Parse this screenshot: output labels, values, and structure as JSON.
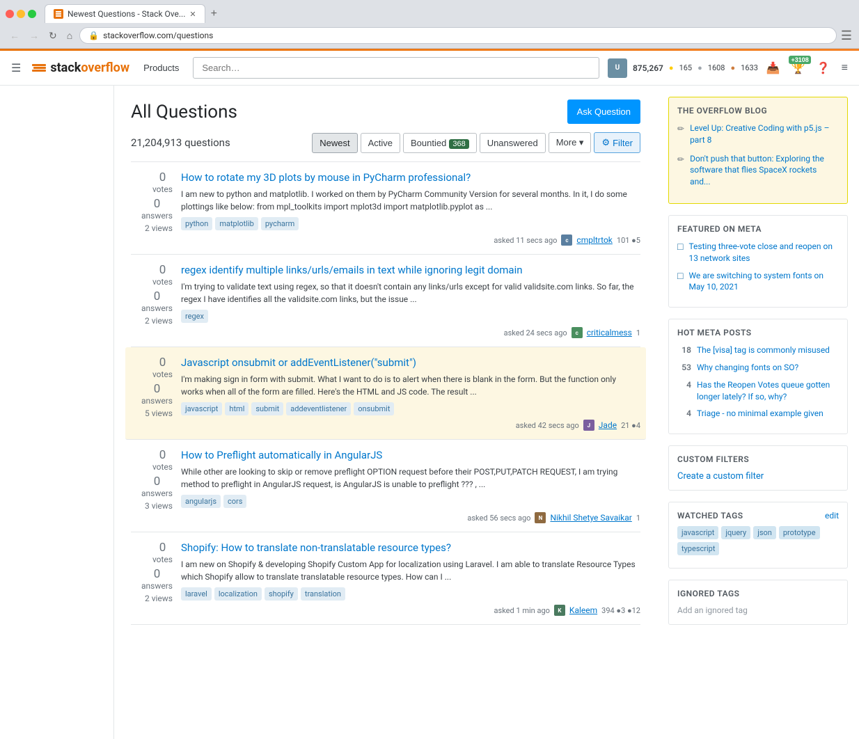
{
  "browser": {
    "tab_title": "Newest Questions - Stack Ove...",
    "url": "stackoverflow.com/questions",
    "nav_back_disabled": true,
    "nav_forward_disabled": true
  },
  "header": {
    "logo_text_main": "stack",
    "logo_text_accent": "overflow",
    "products_label": "Products",
    "search_placeholder": "Search…",
    "user_rep": "875,267",
    "gold_count": "165",
    "silver_count": "1608",
    "bronze_count": "1633",
    "notif_badge": "+3108",
    "hamburger_label": "≡"
  },
  "page": {
    "title": "All Questions",
    "ask_button": "Ask Question",
    "questions_count": "21,204,913 questions",
    "filters": {
      "newest": "Newest",
      "active": "Active",
      "bountied": "Bountied",
      "bountied_count": "368",
      "unanswered": "Unanswered",
      "more": "More",
      "filter": "Filter"
    }
  },
  "questions": [
    {
      "id": 1,
      "votes": 0,
      "answers": 0,
      "views": 2,
      "title": "How to rotate my 3D plots by mouse in PyCharm professional?",
      "excerpt": "I am new to python and matplotlib. I worked on them by PyCharm Community Version for several months. In it, I do some plottings like below: from mpl_toolkits import mplot3d import matplotlib.pyplot as ...",
      "tags": [
        "python",
        "matplotlib",
        "pycharm"
      ],
      "asked_ago": "asked 11 secs ago",
      "user_name": "cmpltrtok",
      "user_rep": "101",
      "user_bronze": "5",
      "avatar_color": "#5a7fa0",
      "highlighted": false
    },
    {
      "id": 2,
      "votes": 0,
      "answers": 0,
      "views": 2,
      "title": "regex identify multiple links/urls/emails in text while ignoring legit domain",
      "excerpt": "I'm trying to validate text using regex, so that it doesn't contain any links/urls except for valid validsite.com links. So far, the regex I have identifies all the validsite.com links, but the issue ...",
      "tags": [
        "regex"
      ],
      "asked_ago": "asked 24 secs ago",
      "user_name": "criticalmess",
      "user_rep": "1",
      "user_bronze": "",
      "avatar_color": "#4a8f5f",
      "highlighted": false
    },
    {
      "id": 3,
      "votes": 0,
      "answers": 0,
      "views": 5,
      "title": "Javascript onsubmit or addEventListener(\"submit\")",
      "excerpt": "I'm making sign in form with submit. What I want to do is to alert when there is blank in the form. But the function only works when all of the form are filled. Here's the HTML and JS code. The result ...",
      "tags": [
        "javascript",
        "html",
        "submit",
        "addeventlistener",
        "onsubmit"
      ],
      "asked_ago": "asked 42 secs ago",
      "user_name": "Jade",
      "user_rep": "21",
      "user_bronze": "4",
      "avatar_color": "#7a5f9f",
      "highlighted": true
    },
    {
      "id": 4,
      "votes": 0,
      "answers": 0,
      "views": 3,
      "title": "How to Preflight automatically in AngularJS",
      "excerpt": "While other are looking to skip or remove preflight OPTION request before their POST,PUT,PATCH REQUEST, I am trying method to preflight in AngularJS request, is AngularJS is unable to preflight ??? , ...",
      "tags": [
        "angularjs",
        "cors"
      ],
      "asked_ago": "asked 56 secs ago",
      "user_name": "Nikhil Shetye Savaikar",
      "user_rep": "1",
      "user_bronze": "",
      "avatar_color": "#8f6a40",
      "highlighted": false
    },
    {
      "id": 5,
      "votes": 0,
      "answers": 0,
      "views": 2,
      "title": "Shopify: How to translate non-translatable resource types?",
      "excerpt": "I am new on Shopify & developing Shopify Custom App for localization using Laravel. I am able to translate Resource Types which Shopify allow to translate translatable resource types. How can I ...",
      "tags": [
        "laravel",
        "localization",
        "shopify",
        "translation"
      ],
      "asked_ago": "asked 1 min ago",
      "user_name": "Kaleem",
      "user_rep": "394",
      "user_bronze": "12",
      "avatar_color": "#4a7a5f",
      "highlighted": false
    }
  ],
  "right_sidebar": {
    "overflow_blog_title": "The Overflow Blog",
    "blog_posts": [
      "Level Up: Creative Coding with p5.js – part 8",
      "Don't push that button: Exploring the software that flies SpaceX rockets and..."
    ],
    "featured_meta_title": "Featured on Meta",
    "meta_links": [
      "Testing three-vote close and reopen on 13 network sites",
      "We are switching to system fonts on May 10, 2021"
    ],
    "hot_meta_title": "Hot Meta Posts",
    "hot_meta_items": [
      {
        "count": "18",
        "text": "The [visa] tag is commonly misused"
      },
      {
        "count": "53",
        "text": "Why changing fonts on SO?"
      },
      {
        "count": "4",
        "text": "Has the Reopen Votes queue gotten longer lately? If so, why?"
      },
      {
        "count": "4",
        "text": "Triage - no minimal example given"
      }
    ],
    "custom_filters_title": "Custom Filters",
    "create_filter_link": "Create a custom filter",
    "watched_tags_title": "Watched Tags",
    "edit_label": "edit",
    "watched_tags": [
      "javascript",
      "jquery",
      "json",
      "prototype",
      "typescript"
    ],
    "ignored_tags_title": "Ignored Tags",
    "add_ignored_tag": "Add an ignored tag"
  }
}
